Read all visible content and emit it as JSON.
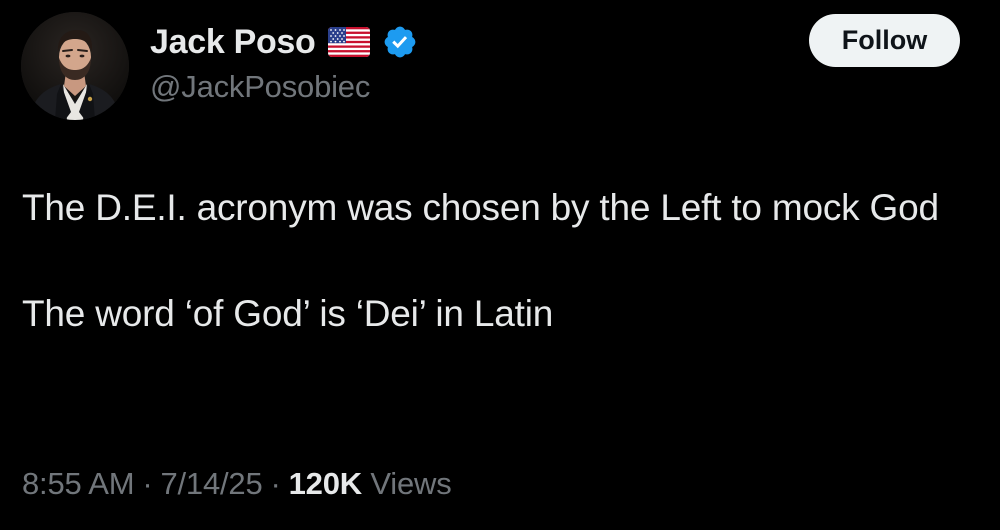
{
  "author": {
    "display_name": "Jack Poso",
    "handle": "@JackPosobiec",
    "flag_icon": "us-flag-icon",
    "verified_icon": "verified-badge-icon",
    "verified_color": "#1d9bf0"
  },
  "actions": {
    "follow_label": "Follow"
  },
  "tweet": {
    "line1": "The D.E.I. acronym was chosen by the Left to mock God",
    "line2": "The word ‘of God’ is ‘Dei’ in Latin"
  },
  "meta": {
    "time": "8:55 AM",
    "separator": "·",
    "date": "7/14/25",
    "views_count": "120K",
    "views_label": "Views"
  },
  "colors": {
    "background": "#000000",
    "primary_text": "#e7e9ea",
    "secondary_text": "#71767b",
    "follow_bg": "#eff3f4"
  }
}
